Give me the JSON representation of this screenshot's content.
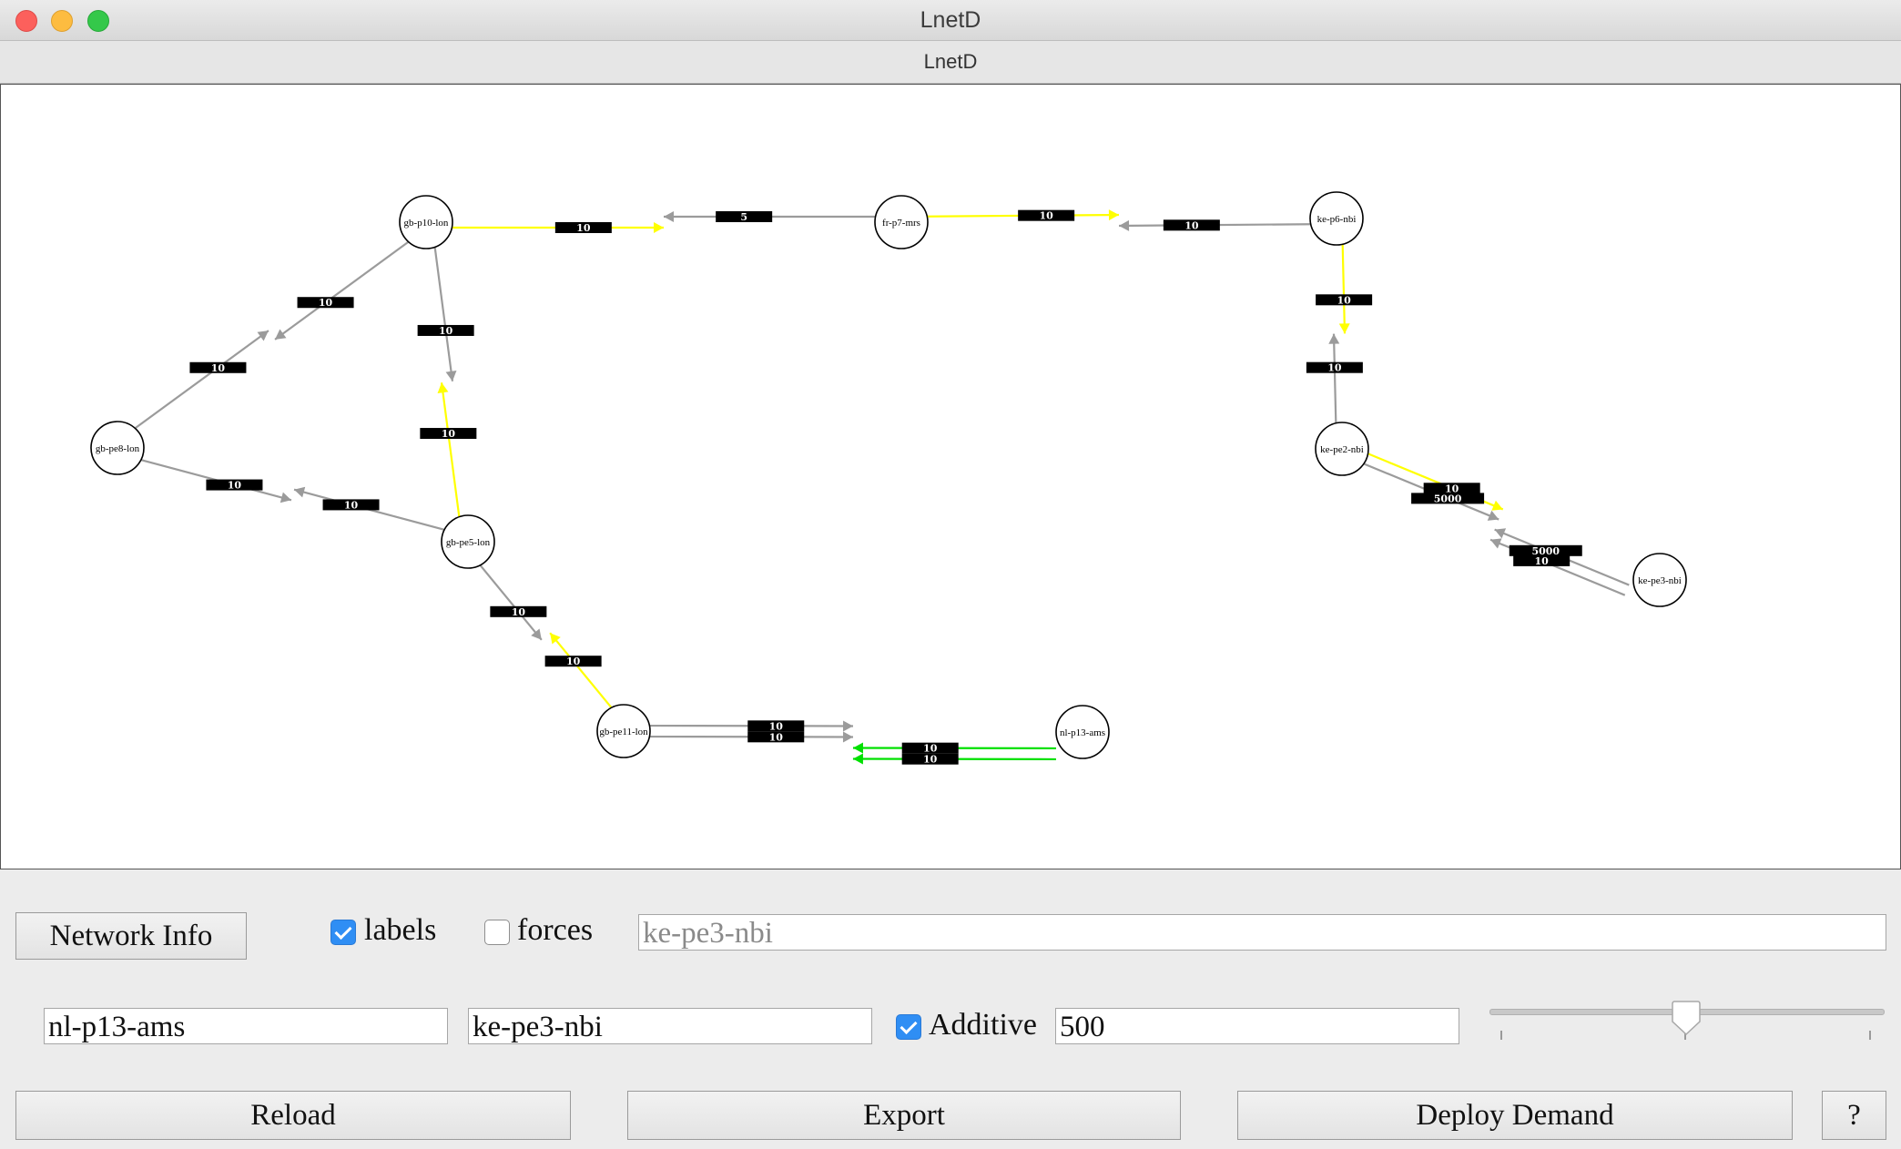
{
  "window": {
    "title": "LnetD"
  },
  "app": {
    "header": "LnetD"
  },
  "graph": {
    "nodes": [
      {
        "id": "gb-p10-lon",
        "label": "gb-p10-lon"
      },
      {
        "id": "fr-p7-mrs",
        "label": "fr-p7-mrs"
      },
      {
        "id": "ke-p6-nbi",
        "label": "ke-p6-nbi"
      },
      {
        "id": "gb-pe8-lon",
        "label": "gb-pe8-lon"
      },
      {
        "id": "gb-pe5-lon",
        "label": "gb-pe5-lon"
      },
      {
        "id": "gb-pe11-lon",
        "label": "gb-pe11-lon"
      },
      {
        "id": "nl-p13-ams",
        "label": "nl-p13-ams"
      },
      {
        "id": "ke-pe2-nbi",
        "label": "ke-pe2-nbi"
      },
      {
        "id": "ke-pe3-nbi",
        "label": "ke-pe3-nbi"
      }
    ],
    "links": [
      {
        "from": "gb-p10-lon",
        "to": "fr-p7-mrs",
        "metric": "10",
        "state": "loaded"
      },
      {
        "from": "fr-p7-mrs",
        "to": "gb-p10-lon",
        "metric": "5",
        "state": "idle"
      },
      {
        "from": "fr-p7-mrs",
        "to": "ke-p6-nbi",
        "metric": "10",
        "state": "loaded"
      },
      {
        "from": "ke-p6-nbi",
        "to": "fr-p7-mrs",
        "metric": "10",
        "state": "idle"
      },
      {
        "from": "ke-p6-nbi",
        "to": "ke-pe2-nbi",
        "metric": "10",
        "state": "loaded"
      },
      {
        "from": "ke-pe2-nbi",
        "to": "ke-p6-nbi",
        "metric": "10",
        "state": "idle"
      },
      {
        "from": "gb-p10-lon",
        "to": "gb-pe8-lon",
        "metric": "10",
        "state": "idle"
      },
      {
        "from": "gb-pe8-lon",
        "to": "gb-p10-lon",
        "metric": "10",
        "state": "idle"
      },
      {
        "from": "gb-p10-lon",
        "to": "gb-pe5-lon",
        "metric": "10",
        "state": "idle"
      },
      {
        "from": "gb-pe5-lon",
        "to": "gb-p10-lon",
        "metric": "10",
        "state": "loaded"
      },
      {
        "from": "gb-pe8-lon",
        "to": "gb-pe5-lon",
        "metric": "10",
        "state": "idle"
      },
      {
        "from": "gb-pe5-lon",
        "to": "gb-pe8-lon",
        "metric": "10",
        "state": "idle"
      },
      {
        "from": "gb-pe5-lon",
        "to": "gb-pe11-lon",
        "metric": "10",
        "state": "idle"
      },
      {
        "from": "gb-pe11-lon",
        "to": "gb-pe5-lon",
        "metric": "10",
        "state": "loaded"
      },
      {
        "from": "gb-pe11-lon",
        "to": "nl-p13-ams",
        "metric": "10",
        "state": "idle"
      },
      {
        "from": "gb-pe11-lon",
        "to": "nl-p13-ams",
        "metric": "10",
        "state": "idle"
      },
      {
        "from": "nl-p13-ams",
        "to": "gb-pe11-lon",
        "metric": "10",
        "state": "demand"
      },
      {
        "from": "nl-p13-ams",
        "to": "gb-pe11-lon",
        "metric": "10",
        "state": "demand"
      },
      {
        "from": "ke-pe2-nbi",
        "to": "ke-pe3-nbi",
        "metric": "10",
        "state": "loaded"
      },
      {
        "from": "ke-pe2-nbi",
        "to": "ke-pe3-nbi",
        "metric": "5000",
        "state": "idle"
      },
      {
        "from": "ke-pe3-nbi",
        "to": "ke-pe2-nbi",
        "metric": "5000",
        "state": "idle"
      },
      {
        "from": "ke-pe3-nbi",
        "to": "ke-pe2-nbi",
        "metric": "10",
        "state": "idle"
      }
    ]
  },
  "controls": {
    "network_info_label": "Network Info",
    "labels_checkbox": {
      "label": "labels",
      "checked": true
    },
    "forces_checkbox": {
      "label": "forces",
      "checked": false
    },
    "search_field": {
      "placeholder": "ke-pe3-nbi"
    },
    "source_field": {
      "value": "nl-p13-ams"
    },
    "destination_field": {
      "value": "ke-pe3-nbi"
    },
    "additive_checkbox": {
      "label": "Additive",
      "checked": true
    },
    "demand_field": {
      "value": "500"
    },
    "demand_slider": {
      "position_fraction": 0.5
    },
    "reload_label": "Reload",
    "export_label": "Export",
    "deploy_label": "Deploy Demand",
    "help_label": "?"
  },
  "colors": {
    "link_idle": "#9b9b9b",
    "link_loaded": "#ffff00",
    "link_demand": "#00e000",
    "label_bg": "#000000",
    "check_accent": "#2f8ef4"
  }
}
